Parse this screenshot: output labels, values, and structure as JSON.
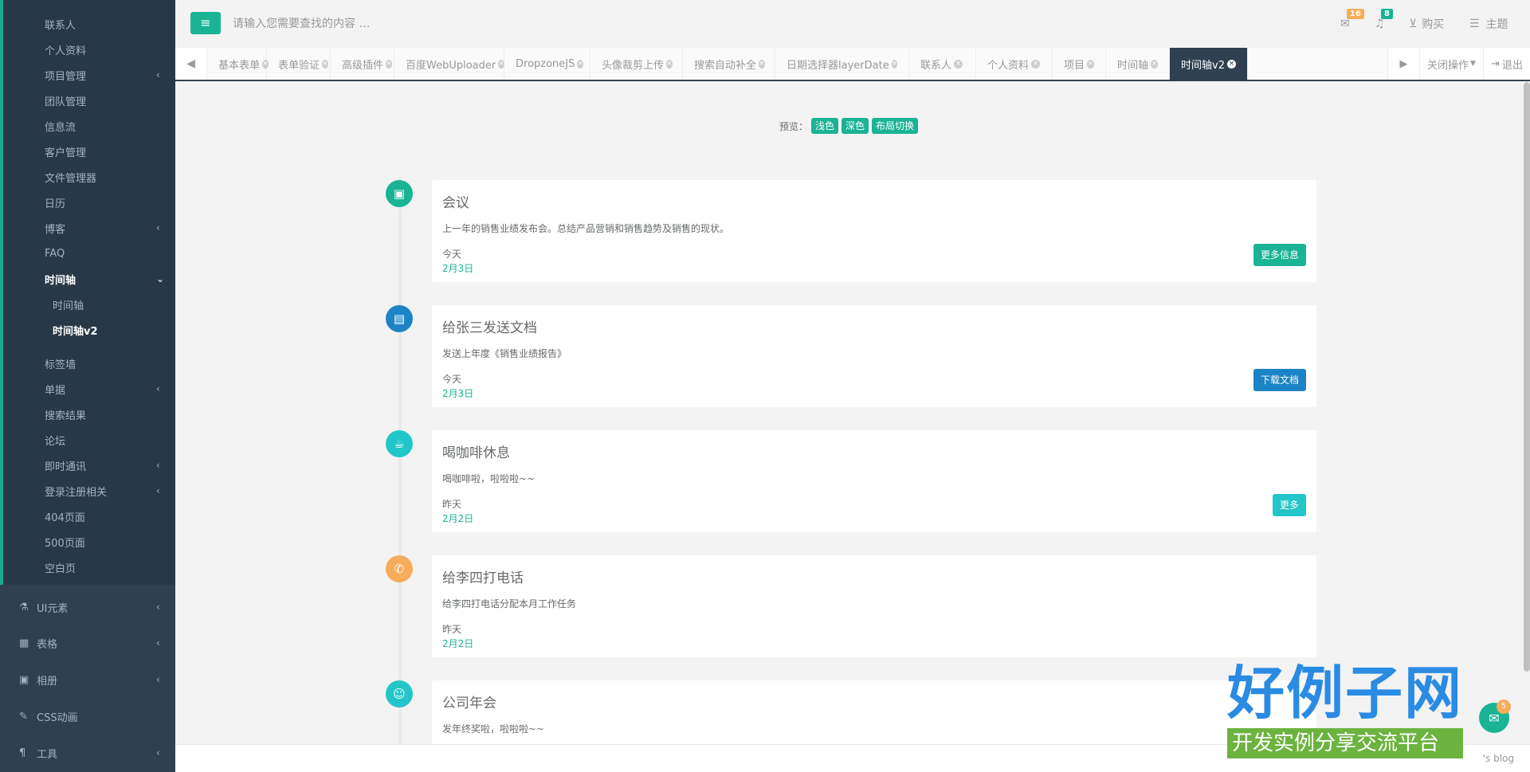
{
  "sidebar": {
    "items": [
      {
        "label": "联系人"
      },
      {
        "label": "个人资料"
      },
      {
        "label": "项目管理",
        "arrow": "‹"
      },
      {
        "label": "团队管理"
      },
      {
        "label": "信息流"
      },
      {
        "label": "客户管理"
      },
      {
        "label": "文件管理器"
      },
      {
        "label": "日历"
      },
      {
        "label": "博客",
        "arrow": "‹"
      },
      {
        "label": "FAQ"
      },
      {
        "label": "时间轴",
        "arrow": "⌄"
      },
      {
        "label": "时间轴"
      },
      {
        "label": "时间轴v2"
      },
      {
        "label": "标签墙"
      },
      {
        "label": "单据",
        "arrow": "‹"
      },
      {
        "label": "搜索结果"
      },
      {
        "label": "论坛"
      },
      {
        "label": "即时通讯",
        "arrow": "‹"
      },
      {
        "label": "登录注册相关",
        "arrow": "‹"
      },
      {
        "label": "404页面"
      },
      {
        "label": "500页面"
      },
      {
        "label": "空白页"
      }
    ],
    "top_items": [
      {
        "label": "UI元素",
        "icon": "flask-icon",
        "arrow": "‹"
      },
      {
        "label": "表格",
        "icon": "table-icon",
        "arrow": "‹"
      },
      {
        "label": "相册",
        "icon": "picture-icon",
        "arrow": "‹"
      },
      {
        "label": "CSS动画",
        "icon": "magic-icon"
      },
      {
        "label": "工具",
        "icon": "cutlery-icon",
        "arrow": "‹"
      }
    ]
  },
  "header": {
    "search_placeholder": "请输入您需要查找的内容 …",
    "mail_count": "16",
    "bell_count": "8",
    "buy_label": "购买",
    "theme_label": "主题",
    "colors": {
      "accent": "#1ab394",
      "mail_badge": "#f8ac59",
      "bell_badge": "#1ab394"
    }
  },
  "tabs": {
    "items": [
      {
        "label": "基本表单"
      },
      {
        "label": "表单验证"
      },
      {
        "label": "高级插件"
      },
      {
        "label": "百度WebUploader"
      },
      {
        "label": "DropzoneJS"
      },
      {
        "label": "头像裁剪上传"
      },
      {
        "label": "搜索自动补全"
      },
      {
        "label": "日期选择器layerDate"
      },
      {
        "label": "联系人"
      },
      {
        "label": "个人资料"
      },
      {
        "label": "项目"
      },
      {
        "label": "时间轴"
      },
      {
        "label": "时间轴v2"
      }
    ],
    "close_label": "关闭操作",
    "logout_label": "退出"
  },
  "preview": {
    "label": "预览：",
    "buttons": [
      "浅色",
      "深色",
      "布局切换"
    ]
  },
  "timeline": [
    {
      "title": "会议",
      "desc": "上一年的销售业绩发布会。总结产品营销和销售趋势及销售的现状。",
      "when": "今天",
      "date": "2月3日",
      "button": "更多信息",
      "icon": "briefcase-icon",
      "icon_color": "#1ab394",
      "button_color": "#1ab394"
    },
    {
      "title": "给张三发送文档",
      "desc": "发送上年度《销售业绩报告》",
      "when": "今天",
      "date": "2月3日",
      "button": "下载文档",
      "icon": "file-icon",
      "icon_color": "#1c84c6",
      "button_color": "#1c84c6"
    },
    {
      "title": "喝咖啡休息",
      "desc": "喝咖啡啦，啦啦啦~~",
      "when": "昨天",
      "date": "2月2日",
      "button": "更多",
      "icon": "coffee-icon",
      "icon_color": "#23c6c8",
      "button_color": "#23c6c8"
    },
    {
      "title": "给李四打电话",
      "desc": "给李四打电话分配本月工作任务",
      "when": "昨天",
      "date": "2月2日",
      "button": "",
      "icon": "phone-icon",
      "icon_color": "#f8ac59",
      "button_color": ""
    },
    {
      "title": "公司年会",
      "desc": "发年终奖啦，啦啦啦~~",
      "when": "",
      "date": "",
      "button": "",
      "icon": "users-icon",
      "icon_color": "#23c6c8",
      "button_color": ""
    }
  ],
  "footer": {
    "text": "'s blog"
  },
  "chat": {
    "count": "5"
  },
  "watermark": {
    "big": "好例子网",
    "small": "开发实例分享交流平台"
  }
}
